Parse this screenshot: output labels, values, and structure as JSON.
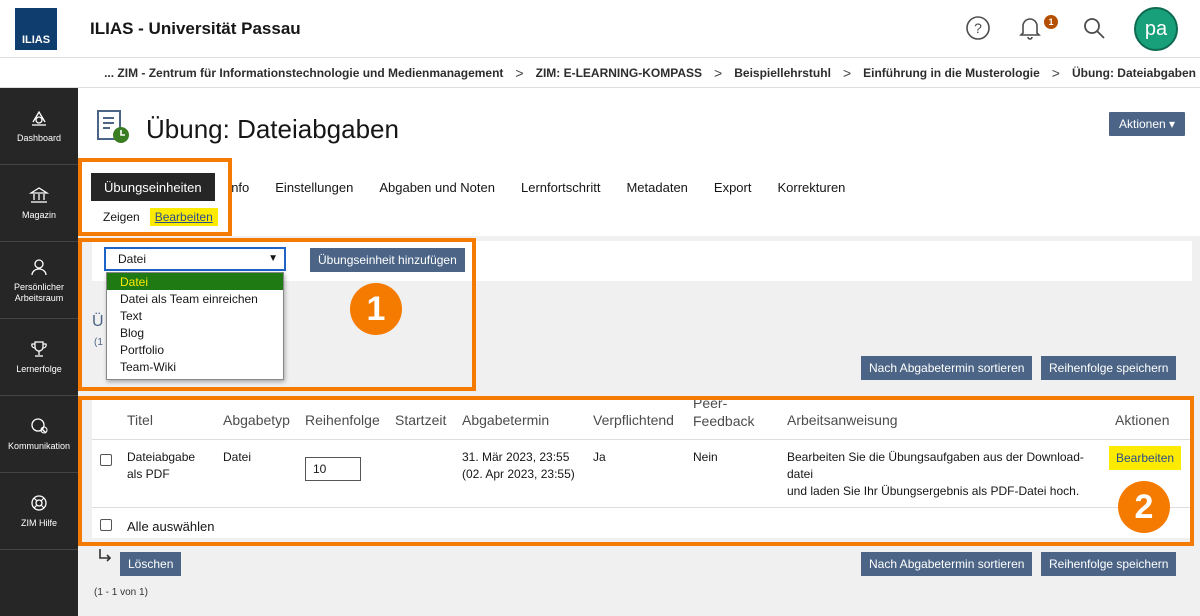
{
  "header": {
    "logo_text": "ILIAS",
    "title": "ILIAS - Universität Passau",
    "notification_count": "1",
    "avatar_initials": "pa"
  },
  "breadcrumb": [
    "... ZIM - Zentrum für Informationstechnologie und Medienmanagement",
    "ZIM: E-LEARNING-KOMPASS",
    "Beispiellehrstuhl",
    "Einführung in die Musterologie",
    "Übung: Dateiabgaben"
  ],
  "mainbar": [
    {
      "label": "Dashboard",
      "icon": "dashboard-icon"
    },
    {
      "label": "Magazin",
      "icon": "bank-icon"
    },
    {
      "label": "Persönlicher Arbeitsraum",
      "icon": "person-icon"
    },
    {
      "label": "Lernerfolge",
      "icon": "trophy-icon"
    },
    {
      "label": "Kommunikation",
      "icon": "chat-icon"
    },
    {
      "label": "ZIM Hilfe",
      "icon": "lifebuoy-icon"
    }
  ],
  "page": {
    "title": "Übung: Dateiabgaben",
    "actions_label": "Aktionen ▾"
  },
  "tabs": [
    "Übungseinheiten",
    "Info",
    "Einstellungen",
    "Abgaben und Noten",
    "Lernfortschritt",
    "Metadaten",
    "Export",
    "Korrekturen"
  ],
  "subtabs": [
    "Zeigen",
    "Bearbeiten"
  ],
  "toolbar": {
    "select_value": "Datei",
    "add_button": "Übungseinheit hinzufügen",
    "options": [
      "Datei",
      "Datei als Team einreichen",
      "Text",
      "Blog",
      "Portfolio",
      "Team-Wiki"
    ]
  },
  "hidden_peek": {
    "letter": "Ü",
    "count": "(1"
  },
  "buttons": {
    "sort": "Nach Abgabetermin sortieren",
    "save_order": "Reihenfolge speichern",
    "delete": "Löschen"
  },
  "table": {
    "headers": [
      "Titel",
      "Abgabetyp",
      "Reihenfolge",
      "Startzeit",
      "Abgabetermin",
      "Verpflichtend",
      "Peer-Feedback",
      "Arbeitsanweisung",
      "Aktionen"
    ],
    "row": {
      "title_l1": "Dateiabgabe",
      "title_l2": "als PDF",
      "type": "Datei",
      "order": "10",
      "deadline_l1": "31. Mär 2023, 23:55",
      "deadline_l2": "(02. Apr 2023, 23:55)",
      "mandatory": "Ja",
      "peer": "Nein",
      "instr_l1": "Bearbeiten Sie die Übungsaufgaben aus der Download-",
      "instr_l2": "datei",
      "instr_l3": "und laden Sie Ihr Übungsergebnis als PDF-Datei hoch.",
      "action": "Bearbeiten"
    },
    "select_all": "Alle auswählen"
  },
  "footer": {
    "count": "(1 - 1 von 1)"
  },
  "annotations": {
    "badge1": "1",
    "badge2": "2",
    "color": "#f47b00"
  }
}
